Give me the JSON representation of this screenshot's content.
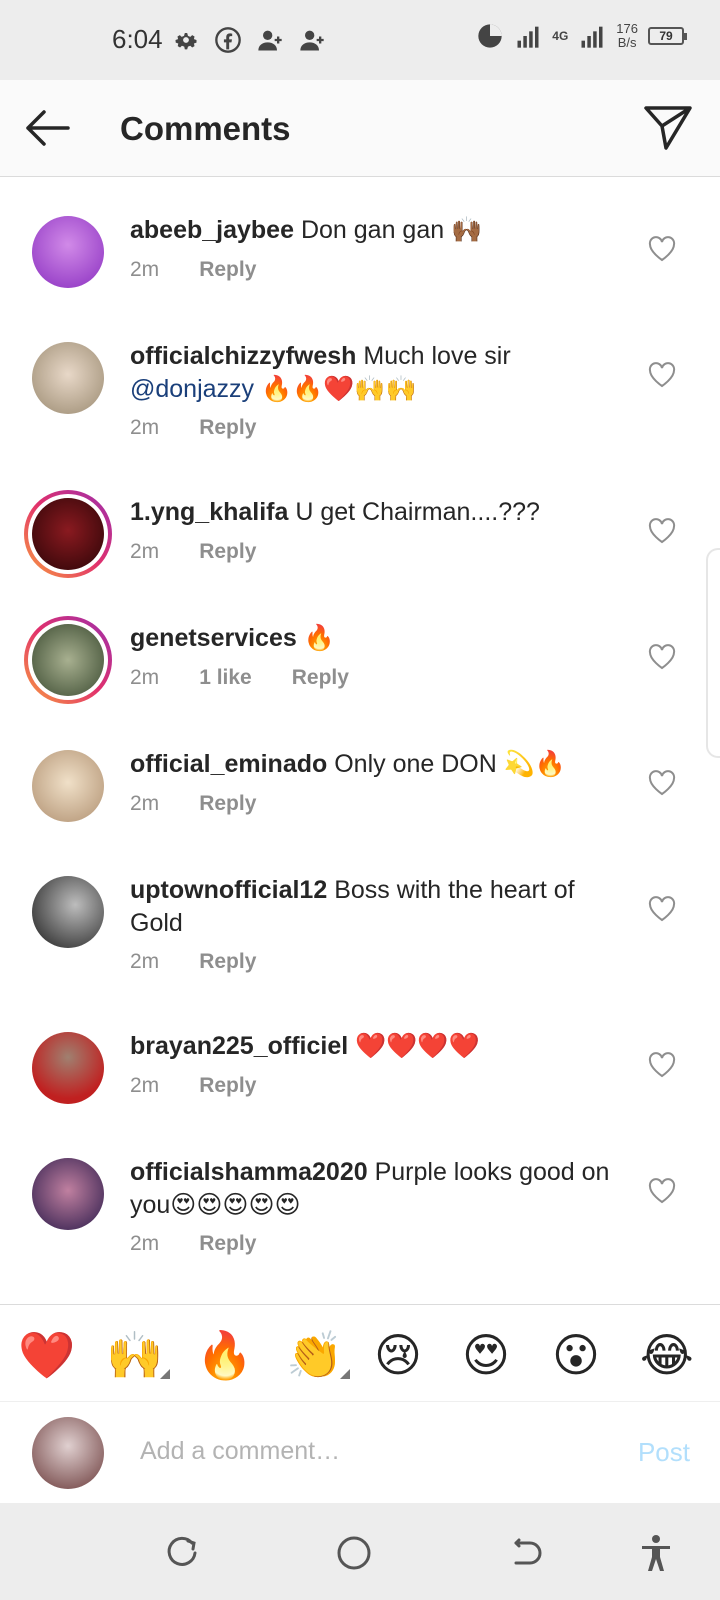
{
  "status_bar": {
    "time": "6:04",
    "network_type": "4G",
    "net_speed_value": "176",
    "net_speed_unit": "B/s",
    "battery": "79"
  },
  "header": {
    "title": "Comments"
  },
  "comments": [
    {
      "username": "abeeb_jaybee",
      "text": "Don gan gan 🙌🏾",
      "time": "2m",
      "reply": "Reply",
      "avatar_color": "#b84ad8"
    },
    {
      "username": "officialchizzyfwesh",
      "text": "Much love sir",
      "mention": "@donjazzy",
      "text_after": " 🔥🔥❤️🙌🙌",
      "time": "2m",
      "reply": "Reply",
      "avatar_color": "#c9b8a0"
    },
    {
      "username": "1.yng_khalifa",
      "text": "U get Chairman....???",
      "time": "2m",
      "reply": "Reply",
      "avatar_color": "#5a0f12",
      "story_ring": true
    },
    {
      "username": "genetservices",
      "text": "🔥",
      "time": "2m",
      "likes": "1 like",
      "reply": "Reply",
      "avatar_color": "#6e7a5a",
      "story_ring": true
    },
    {
      "username": "official_eminado",
      "text": "Only one DON 💫🔥",
      "time": "2m",
      "reply": "Reply",
      "avatar_color": "#d8c4a8"
    },
    {
      "username": "uptownofficial12",
      "text": "Boss with the heart of Gold",
      "time": "2m",
      "reply": "Reply",
      "avatar_color": "#3a3a3a"
    },
    {
      "username": "brayan225_officiel",
      "text": "❤️❤️❤️❤️",
      "time": "2m",
      "reply": "Reply",
      "avatar_color": "#b82a2a"
    },
    {
      "username": "officialshamma2020",
      "text": "Purple looks good on you😍😍😍😍😍",
      "time": "2m",
      "reply": "Reply",
      "avatar_color": "#4a2a6a"
    }
  ],
  "reactions": [
    "❤️",
    "🙌",
    "🔥",
    "👏",
    "😢",
    "😍",
    "😮",
    "😂"
  ],
  "composer": {
    "placeholder": "Add a comment…",
    "post_label": "Post",
    "avatar_color": "#7a4a4a"
  },
  "colors": {
    "accent_blue": "#0095f6",
    "post_disabled": "#b2dffc",
    "meta_gray": "#8e8e8e",
    "mention": "#1a3f7a"
  },
  "icons": {
    "header_back": "back-arrow-icon",
    "header_send": "paper-plane-icon",
    "comment_like": "heart-outline-icon",
    "nav": [
      "recent-apps-icon",
      "home-circle-icon",
      "back-nav-icon",
      "accessibility-icon"
    ]
  }
}
